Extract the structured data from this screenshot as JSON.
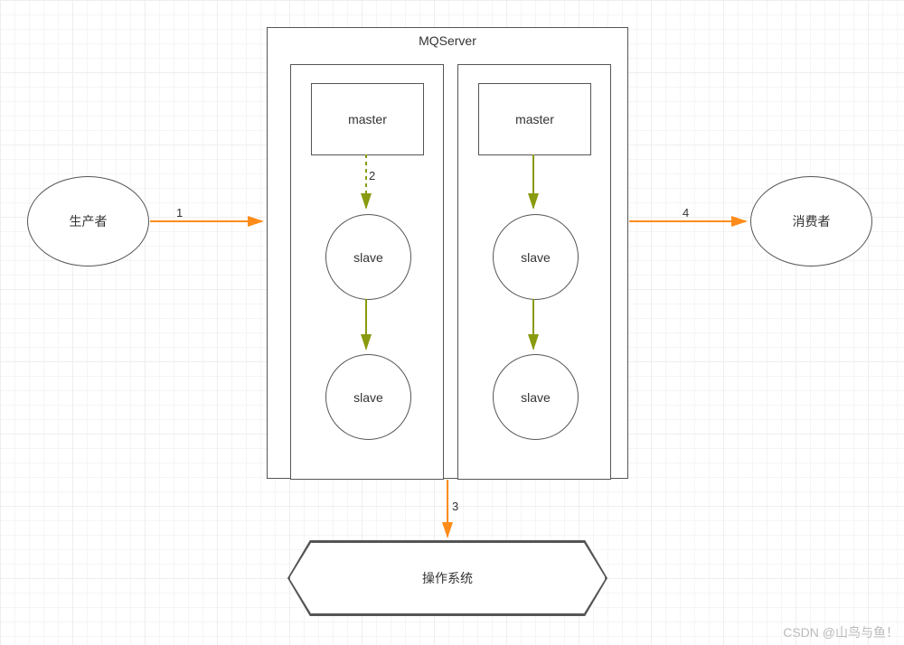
{
  "producer": "生产者",
  "consumer": "消费者",
  "mqserver": {
    "title": "MQServer"
  },
  "group_left": {
    "master": "master",
    "slave1": "slave",
    "slave2": "slave"
  },
  "group_right": {
    "master": "master",
    "slave1": "slave",
    "slave2": "slave"
  },
  "os": "操作系统",
  "arrows": {
    "a1": "1",
    "a2": "2",
    "a3": "3",
    "a4": "4"
  },
  "watermark": "CSDN @山鸟与鱼！"
}
